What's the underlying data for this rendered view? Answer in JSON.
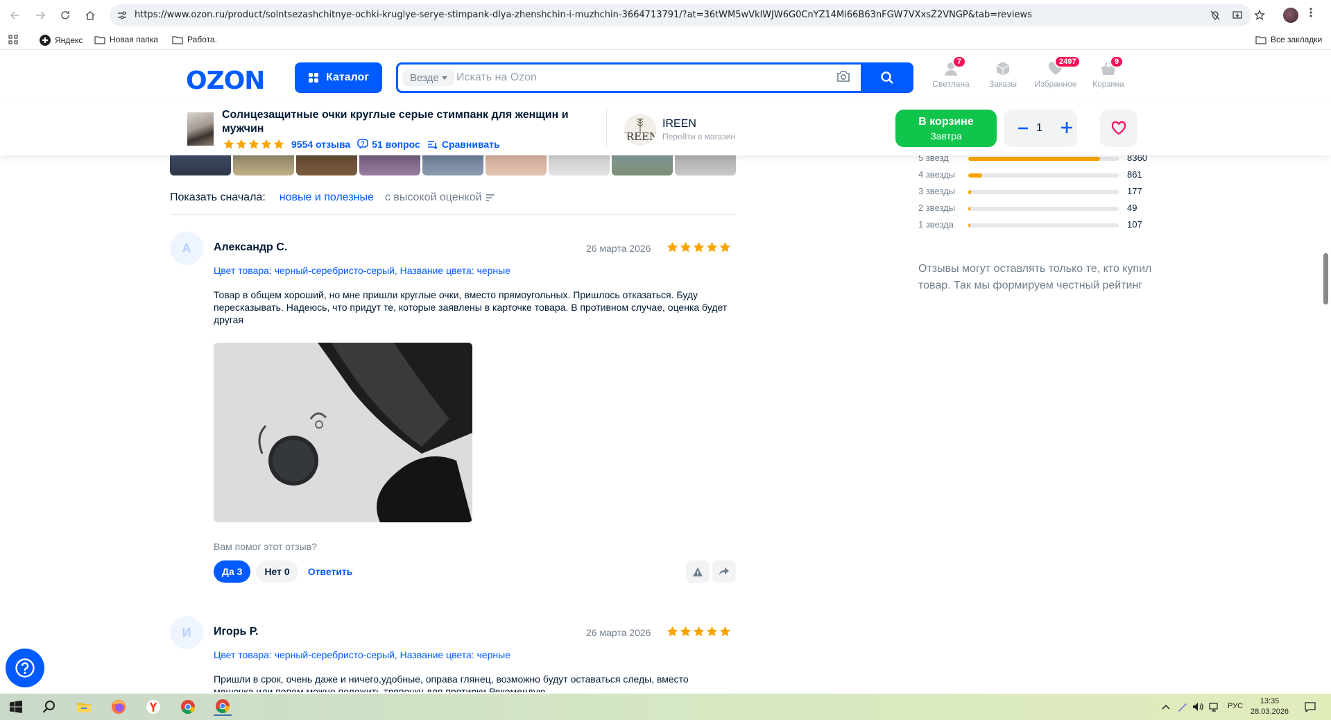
{
  "browser": {
    "url": "https://www.ozon.ru/product/solntsezashchitnye-ochki-kruglye-serye-stimpank-dlya-zhenshchin-i-muzhchin-3664713791/?at=36tWM5wVklWJW6G0CnYZ14Mi66B63nFGW7VXxsZ2VNGP&tab=reviews",
    "bookmarks": [
      "Яндекс",
      "Новая папка",
      "Работа."
    ],
    "all_bookmarks": "Все закладки"
  },
  "header": {
    "logo": "OZON",
    "catalog_label": "Каталог",
    "search_scope": "Везде",
    "search_placeholder": "Искать на Ozon",
    "items": [
      {
        "label": "Светлана",
        "badge": "7"
      },
      {
        "label": "Заказы",
        "badge": ""
      },
      {
        "label": "Избранное",
        "badge": "2497"
      },
      {
        "label": "Корзина",
        "badge": "9"
      }
    ]
  },
  "product": {
    "title": "Солнцезащитные очки круглые серые стимпанк для женщин и мужчин",
    "reviews_count": "9554 отзыва",
    "questions_count": "51 вопрос",
    "compare_label": "Сравнивать",
    "rating_stars": 5
  },
  "seller": {
    "name": "IREEN",
    "logo_text": "IREEN",
    "link": "Перейти в магазин"
  },
  "cart": {
    "button_main": "В корзине",
    "button_sub": "Завтра",
    "quantity": "1"
  },
  "sort": {
    "label": "Показать сначала:",
    "option_active": "новые и полезные",
    "option_other": "с высокой оценкой"
  },
  "rating_breakdown": [
    {
      "label": "5 звезд",
      "count": "8360",
      "fraction": 0.875
    },
    {
      "label": "4 звезды",
      "count": "861",
      "fraction": 0.09
    },
    {
      "label": "3 звезды",
      "count": "177",
      "fraction": 0.019
    },
    {
      "label": "2 звезды",
      "count": "49",
      "fraction": 0.005
    },
    {
      "label": "1 звезда",
      "count": "107",
      "fraction": 0.011
    }
  ],
  "reviews_note": "Отзывы могут оставлять только те, кто купил товар. Так мы формируем честный рейтинг",
  "reviews": [
    {
      "initial": "А",
      "author": "Александр С.",
      "date": "26 марта 2026",
      "stars": 5,
      "variant": "Цвет товара: черный-серебристо-серый, Название цвета: черные",
      "text": "Товар в общем хороший, но мне пришли круглые очки, вместо прямоугольных. Пришлось отказаться. Буду пересказывать. Надеюсь, что придут те, которые заявлены в карточке товара. В противном случае, оценка будет другая",
      "helpful_question": "Вам помог этот отзыв?",
      "yes_label": "Да 3",
      "no_label": "Нет 0",
      "reply_label": "Ответить"
    },
    {
      "initial": "И",
      "author": "Игорь Р.",
      "date": "26 марта 2026",
      "stars": 5,
      "variant": "Цвет товара: черный-серебристо-серый, Название цвета: черные",
      "text": "Пришли в срок, очень даже и ничего,удобные, оправа глянец, возможно будут оставаться следы, вместо мешочка или попом можно положить тряпочку для протирки.Рекомендую"
    }
  ],
  "taskbar": {
    "language": "РУС",
    "time": "13:35",
    "date": "28.03.2026"
  },
  "colors": {
    "ozon_blue": "#005bff",
    "cart_green": "#10c44c",
    "star_orange": "#f9a400",
    "badge_pink": "#f91155"
  }
}
